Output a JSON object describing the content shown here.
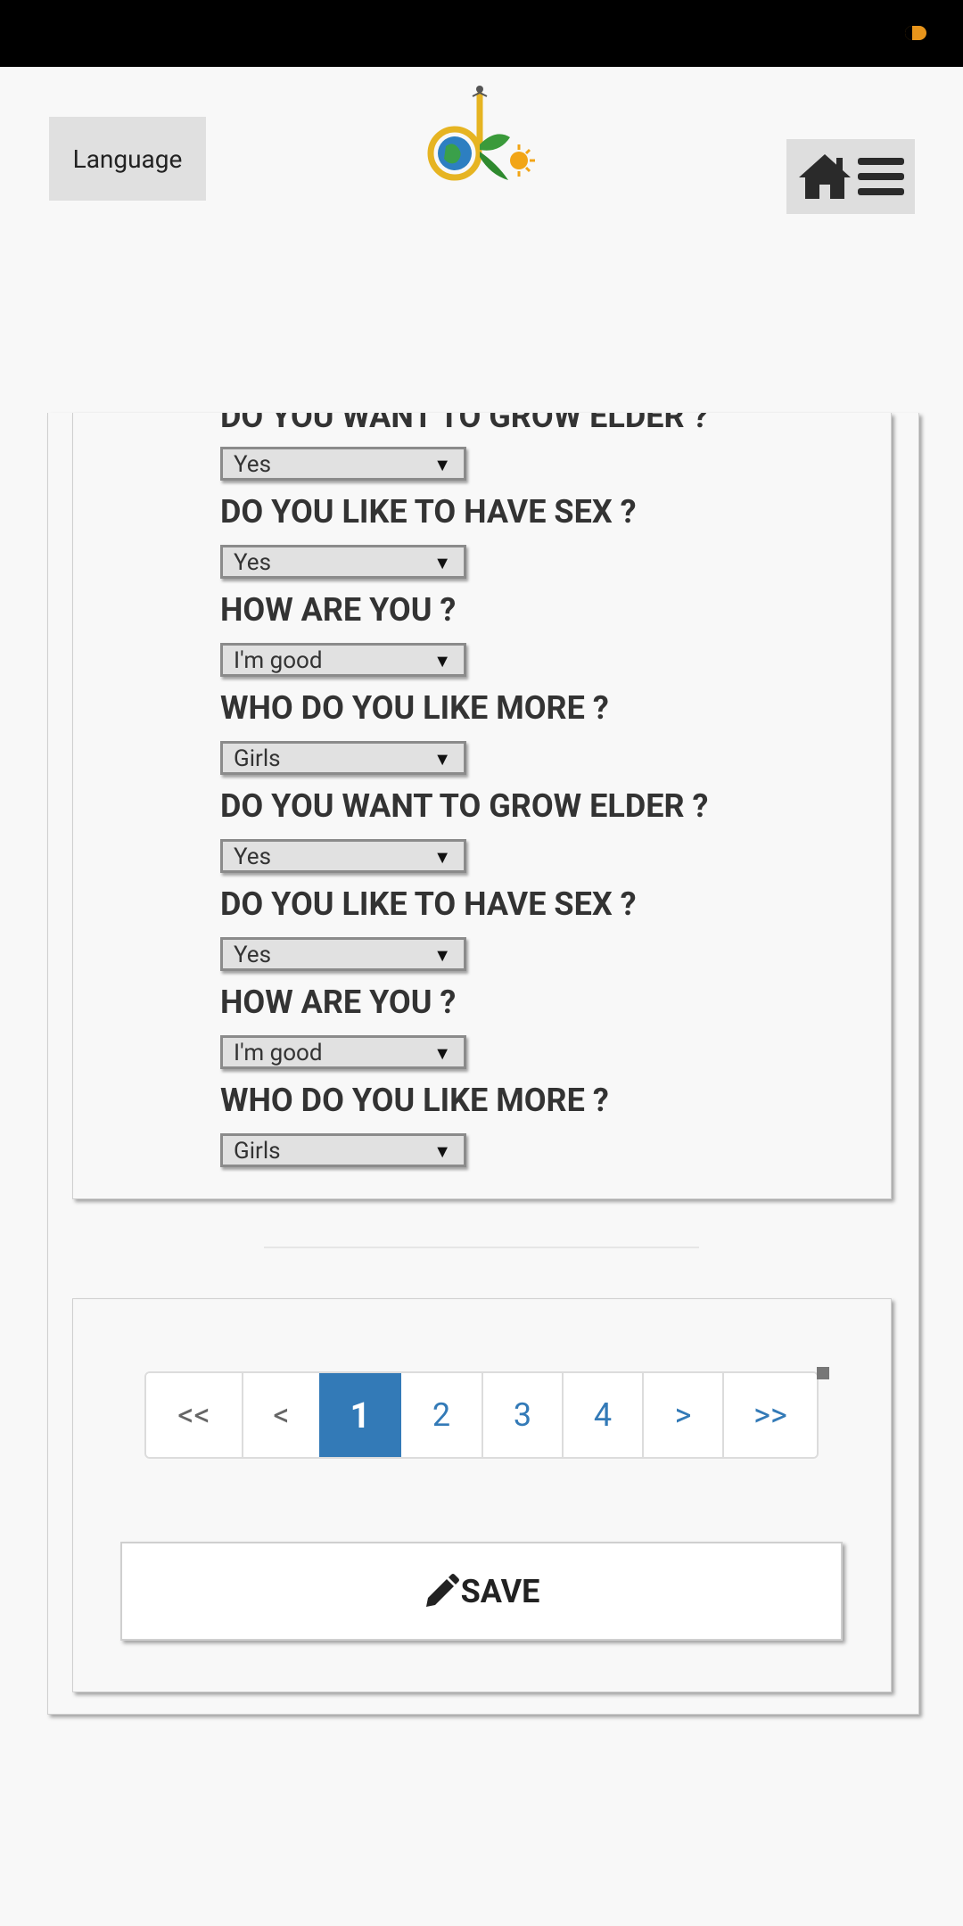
{
  "header": {
    "language_label": "Language"
  },
  "questions": [
    {
      "label": "DO YOU WANT TO GROW ELDER ?",
      "value": "Yes"
    },
    {
      "label": "DO YOU LIKE TO HAVE SEX ?",
      "value": "Yes"
    },
    {
      "label": "HOW ARE YOU ?",
      "value": "I'm good"
    },
    {
      "label": "WHO DO YOU LIKE MORE ?",
      "value": "Girls"
    },
    {
      "label": "DO YOU WANT TO GROW ELDER ?",
      "value": "Yes"
    },
    {
      "label": "DO YOU LIKE TO HAVE SEX ?",
      "value": "Yes"
    },
    {
      "label": "HOW ARE YOU ?",
      "value": "I'm good"
    },
    {
      "label": "WHO DO YOU LIKE MORE ?",
      "value": "Girls"
    }
  ],
  "pagination": {
    "first": "<<",
    "prev": "<",
    "pages": [
      "1",
      "2",
      "3",
      "4"
    ],
    "current": "1",
    "next": ">",
    "last": ">>"
  },
  "save_label": "SAVE",
  "colors": {
    "accent": "#337ab7",
    "logo_gold": "#e6b422",
    "logo_green": "#3a9a3a"
  },
  "icons": {
    "home": "home-icon",
    "menu": "hamburger-icon",
    "save": "pencil-icon"
  }
}
